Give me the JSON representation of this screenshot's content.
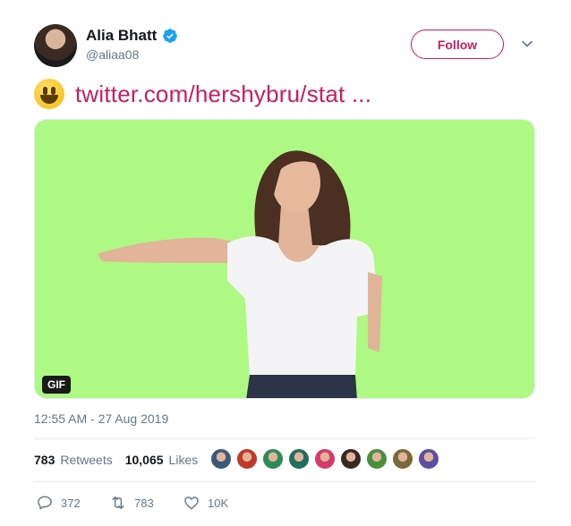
{
  "author": {
    "display_name": "Alia Bhatt",
    "handle": "@aliaa08",
    "verified": true,
    "avatar_icon": "avatar"
  },
  "follow_label": "Follow",
  "accent_color": "#c51f5d",
  "tweet": {
    "emoji": "smiley-emoji",
    "link_text": "twitter.com/hershybru/stat ..."
  },
  "media": {
    "type": "GIF",
    "badge": "GIF",
    "background_color": "#adf983"
  },
  "timestamp": "12:55 AM - 27 Aug 2019",
  "stats": {
    "retweets_count": "783",
    "retweets_label": "Retweets",
    "likes_count": "10,065",
    "likes_label": "Likes"
  },
  "likers_colors": [
    "#3b5a7a",
    "#c0392b",
    "#2e8b57",
    "#1f6f5c",
    "#d63a6a",
    "#3a2a22",
    "#4a8f3a",
    "#7a6a3a",
    "#5a4fa0"
  ],
  "actions": {
    "replies": "372",
    "retweets": "783",
    "likes": "10K"
  }
}
